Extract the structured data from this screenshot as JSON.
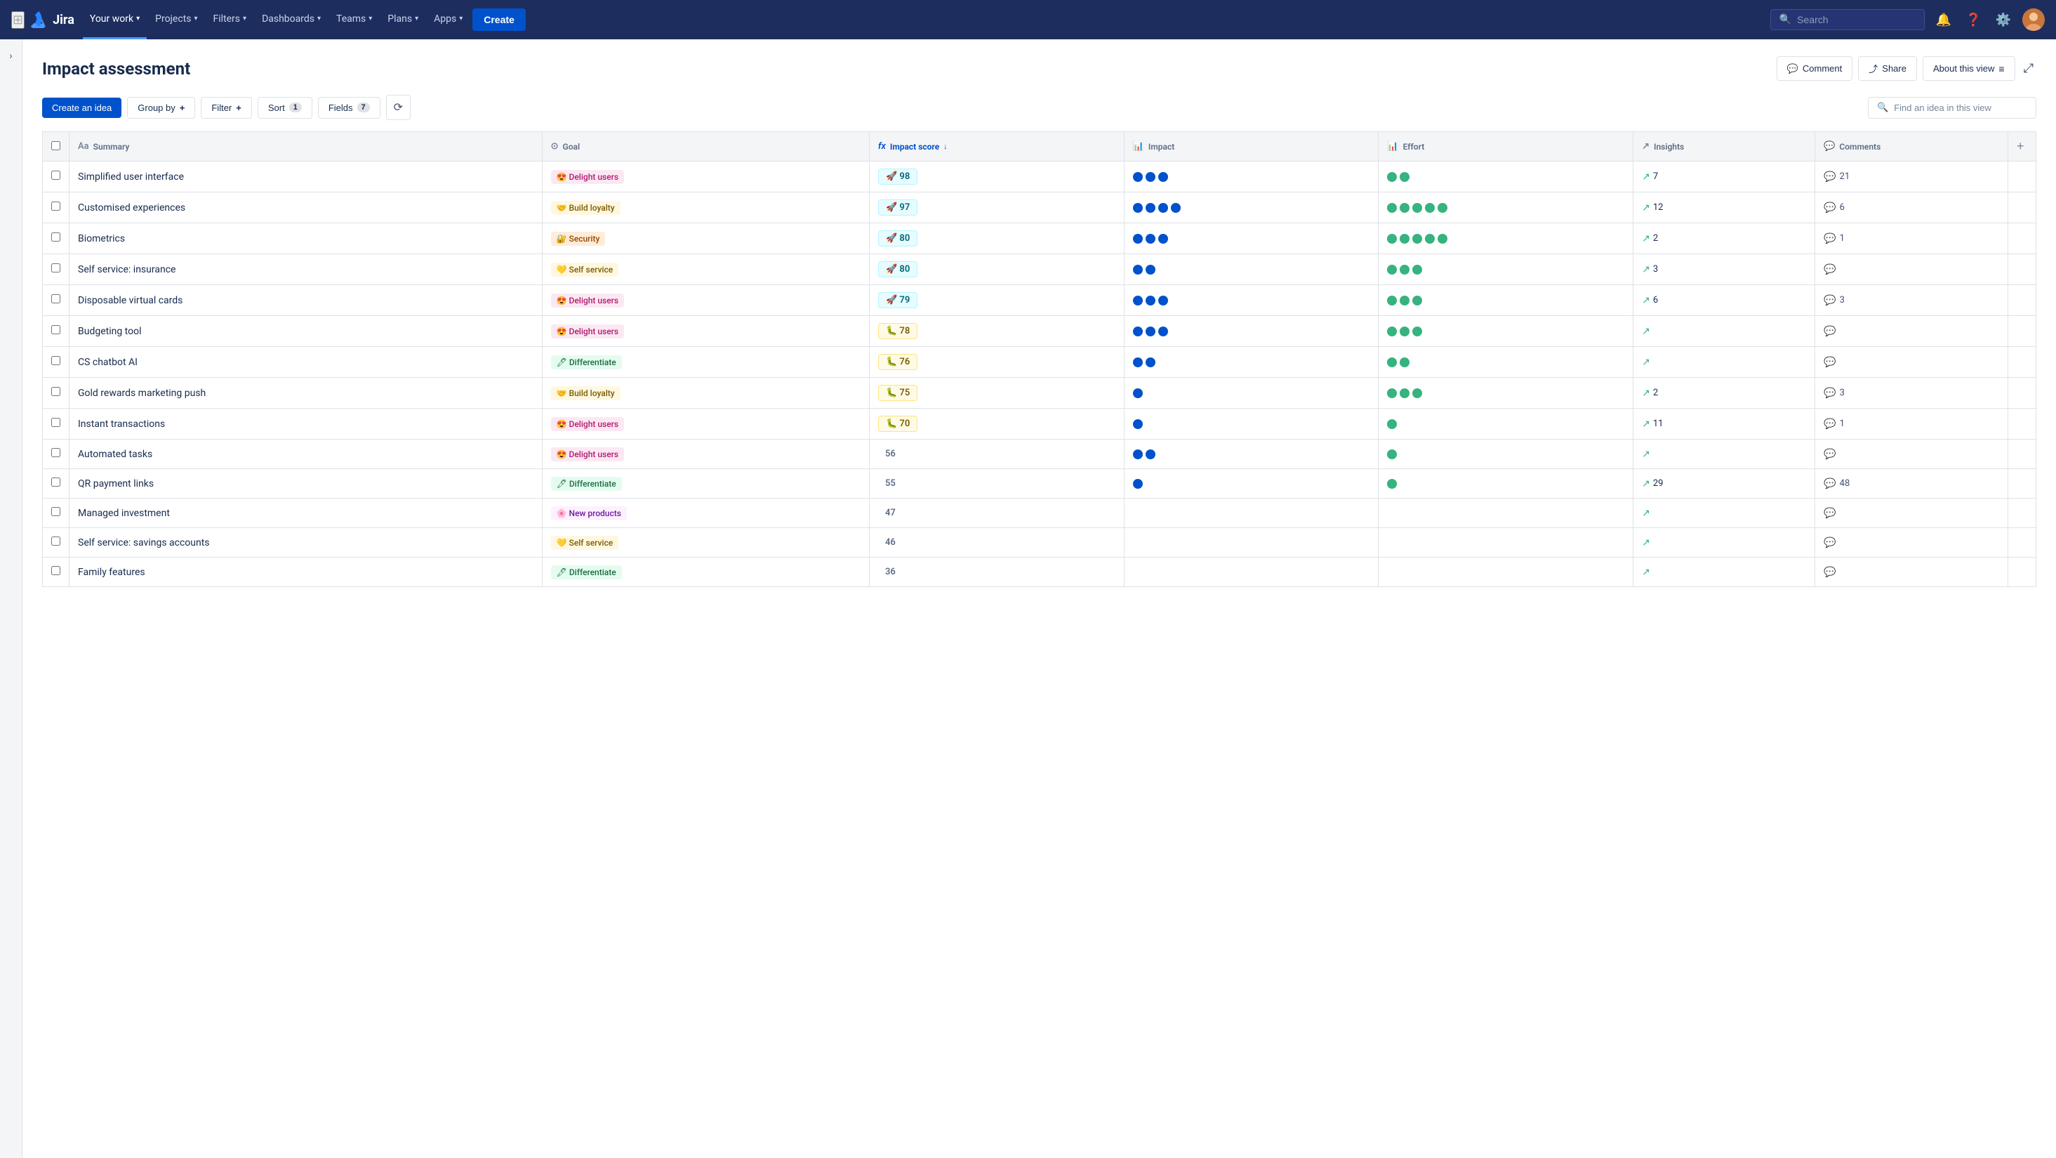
{
  "app": {
    "logo": "Jira",
    "nav_items": [
      {
        "label": "Your work",
        "active": true,
        "has_dropdown": true
      },
      {
        "label": "Projects",
        "active": false,
        "has_dropdown": true
      },
      {
        "label": "Filters",
        "active": false,
        "has_dropdown": true
      },
      {
        "label": "Dashboards",
        "active": false,
        "has_dropdown": true
      },
      {
        "label": "Teams",
        "active": false,
        "has_dropdown": true
      },
      {
        "label": "Plans",
        "active": false,
        "has_dropdown": true
      },
      {
        "label": "Apps",
        "active": false,
        "has_dropdown": true
      }
    ],
    "create_btn": "Create",
    "search_placeholder": "Search"
  },
  "page": {
    "title": "Impact assessment",
    "header_btns": [
      {
        "label": "Comment",
        "icon": "💬"
      },
      {
        "label": "Share",
        "icon": "🔗"
      },
      {
        "label": "About this view",
        "icon": "≡"
      }
    ]
  },
  "toolbar": {
    "create_idea_label": "Create an idea",
    "group_by_label": "Group by",
    "filter_label": "Filter",
    "sort_label": "Sort",
    "sort_count": "1",
    "fields_label": "Fields",
    "fields_count": "7",
    "find_placeholder": "Find an idea in this view"
  },
  "table": {
    "columns": [
      {
        "key": "summary",
        "label": "Summary",
        "icon": "Aa"
      },
      {
        "key": "goal",
        "label": "Goal",
        "icon": "⊙"
      },
      {
        "key": "impact_score",
        "label": "Impact score",
        "icon": "fx",
        "active_sort": true
      },
      {
        "key": "impact",
        "label": "Impact",
        "icon": "📊"
      },
      {
        "key": "effort",
        "label": "Effort",
        "icon": "📊"
      },
      {
        "key": "insights",
        "label": "Insights",
        "icon": "↗"
      },
      {
        "key": "comments",
        "label": "Comments",
        "icon": "💬"
      }
    ],
    "rows": [
      {
        "id": 1,
        "summary": "Simplified user interface",
        "goal_emoji": "😍",
        "goal_label": "Delight users",
        "goal_type": "delight",
        "score": 98,
        "score_type": "high",
        "score_emoji": "🚀",
        "impact_dots": [
          "blue",
          "blue",
          "blue"
        ],
        "effort_dots": [
          "green",
          "green"
        ],
        "insights_val": 7,
        "comments_val": 21
      },
      {
        "id": 2,
        "summary": "Customised experiences",
        "goal_emoji": "🤝",
        "goal_label": "Build loyalty",
        "goal_type": "loyalty",
        "score": 97,
        "score_type": "high",
        "score_emoji": "🚀",
        "impact_dots": [
          "blue",
          "blue",
          "blue",
          "blue"
        ],
        "effort_dots": [
          "green",
          "green",
          "green",
          "green",
          "green"
        ],
        "insights_val": 12,
        "comments_val": 6
      },
      {
        "id": 3,
        "summary": "Biometrics",
        "goal_emoji": "🔐",
        "goal_label": "Security",
        "goal_type": "security",
        "score": 80,
        "score_type": "high",
        "score_emoji": "🚀",
        "impact_dots": [
          "blue",
          "blue",
          "blue"
        ],
        "effort_dots": [
          "green",
          "green",
          "green",
          "green",
          "green"
        ],
        "insights_val": 2,
        "comments_val": 1
      },
      {
        "id": 4,
        "summary": "Self service: insurance",
        "goal_emoji": "💛",
        "goal_label": "Self service",
        "goal_type": "selfservice",
        "score": 80,
        "score_type": "high",
        "score_emoji": "🚀",
        "impact_dots": [
          "blue",
          "blue"
        ],
        "effort_dots": [
          "green",
          "green",
          "green"
        ],
        "insights_val": 3,
        "comments_val": null
      },
      {
        "id": 5,
        "summary": "Disposable virtual cards",
        "goal_emoji": "😍",
        "goal_label": "Delight users",
        "goal_type": "delight",
        "score": 79,
        "score_type": "high",
        "score_emoji": "🚀",
        "impact_dots": [
          "blue",
          "blue",
          "blue"
        ],
        "effort_dots": [
          "green",
          "green",
          "green"
        ],
        "insights_val": 6,
        "comments_val": 3
      },
      {
        "id": 6,
        "summary": "Budgeting tool",
        "goal_emoji": "😍",
        "goal_label": "Delight users",
        "goal_type": "delight",
        "score": 78,
        "score_type": "medium-high",
        "score_emoji": "🐛",
        "impact_dots": [
          "blue",
          "blue",
          "blue"
        ],
        "effort_dots": [
          "green",
          "green",
          "green"
        ],
        "insights_val": null,
        "comments_val": null
      },
      {
        "id": 7,
        "summary": "CS chatbot AI",
        "goal_emoji": "🖊",
        "goal_label": "Differentiate",
        "goal_type": "differentiate",
        "score": 76,
        "score_type": "medium-high",
        "score_emoji": "🐛",
        "impact_dots": [
          "blue",
          "blue"
        ],
        "effort_dots": [
          "green",
          "green"
        ],
        "insights_val": null,
        "comments_val": null
      },
      {
        "id": 8,
        "summary": "Gold rewards marketing push",
        "goal_emoji": "🤝",
        "goal_label": "Build loyalty",
        "goal_type": "loyalty",
        "score": 75,
        "score_type": "medium-high",
        "score_emoji": "🐛",
        "impact_dots": [
          "blue"
        ],
        "effort_dots": [
          "green",
          "green",
          "green"
        ],
        "insights_val": 2,
        "comments_val": 3
      },
      {
        "id": 9,
        "summary": "Instant transactions",
        "goal_emoji": "😍",
        "goal_label": "Delight users",
        "goal_type": "delight",
        "score": 70,
        "score_type": "medium-high",
        "score_emoji": "🐛",
        "impact_dots": [
          "blue"
        ],
        "effort_dots": [
          "green"
        ],
        "insights_val": 11,
        "comments_val": 1
      },
      {
        "id": 10,
        "summary": "Automated tasks",
        "goal_emoji": "😍",
        "goal_label": "Delight users",
        "goal_type": "delight",
        "score": 56,
        "score_type": "plain",
        "score_emoji": null,
        "impact_dots": [
          "blue",
          "blue"
        ],
        "effort_dots": [
          "green"
        ],
        "insights_val": null,
        "comments_val": null
      },
      {
        "id": 11,
        "summary": "QR payment links",
        "goal_emoji": "🖊",
        "goal_label": "Differentiate",
        "goal_type": "differentiate",
        "score": 55,
        "score_type": "plain",
        "score_emoji": null,
        "impact_dots": [
          "blue"
        ],
        "effort_dots": [
          "green"
        ],
        "insights_val": 29,
        "comments_val": 48
      },
      {
        "id": 12,
        "summary": "Managed investment",
        "goal_emoji": "🌸",
        "goal_label": "New products",
        "goal_type": "newproducts",
        "score": 47,
        "score_type": "plain",
        "score_emoji": null,
        "impact_dots": [],
        "effort_dots": [],
        "insights_val": null,
        "comments_val": null
      },
      {
        "id": 13,
        "summary": "Self service: savings accounts",
        "goal_emoji": "💛",
        "goal_label": "Self service",
        "goal_type": "selfservice",
        "score": 46,
        "score_type": "plain",
        "score_emoji": null,
        "impact_dots": [],
        "effort_dots": [],
        "insights_val": null,
        "comments_val": null
      },
      {
        "id": 14,
        "summary": "Family features",
        "goal_emoji": "🖊",
        "goal_label": "Differentiate",
        "goal_type": "differentiate",
        "score": 36,
        "score_type": "plain",
        "score_emoji": null,
        "impact_dots": [],
        "effort_dots": [],
        "insights_val": null,
        "comments_val": null
      }
    ]
  },
  "colors": {
    "primary": "#0052cc",
    "nav_bg": "#1d2d5e"
  }
}
